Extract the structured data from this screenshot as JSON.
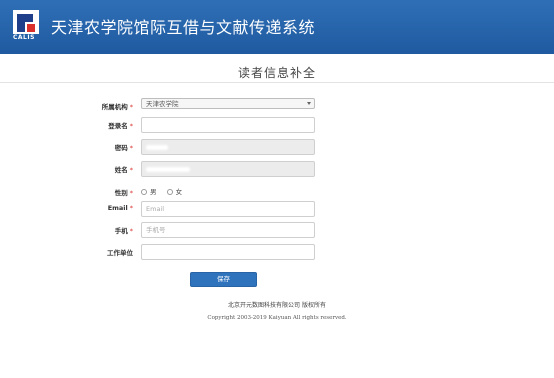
{
  "header": {
    "logo_text": "CALIS",
    "site_title": "天津农学院馆际互借与文献传递系统"
  },
  "page_title": "读者信息补全",
  "form": {
    "required_mark": "*",
    "institution": {
      "label": "所属机构",
      "value": "天津农学院"
    },
    "username": {
      "label": "登录名",
      "value": ""
    },
    "password": {
      "label": "密码"
    },
    "name": {
      "label": "姓名"
    },
    "gender": {
      "label": "性别",
      "options": [
        "男",
        "女"
      ]
    },
    "email": {
      "label": "Email",
      "placeholder": "Email"
    },
    "phone": {
      "label": "手机",
      "placeholder": "手机号"
    },
    "work_unit": {
      "label": "工作单位",
      "value": ""
    },
    "save_label": "保存"
  },
  "footer": {
    "line1": "北京开元数图科技有限公司 版权所有",
    "line2": "Copyright 2003-2019 Kaiyuan All rights reserved."
  },
  "colors": {
    "header_blue": "#1f5aa0",
    "button_blue": "#2f73bd",
    "required_red": "#d9302c"
  }
}
